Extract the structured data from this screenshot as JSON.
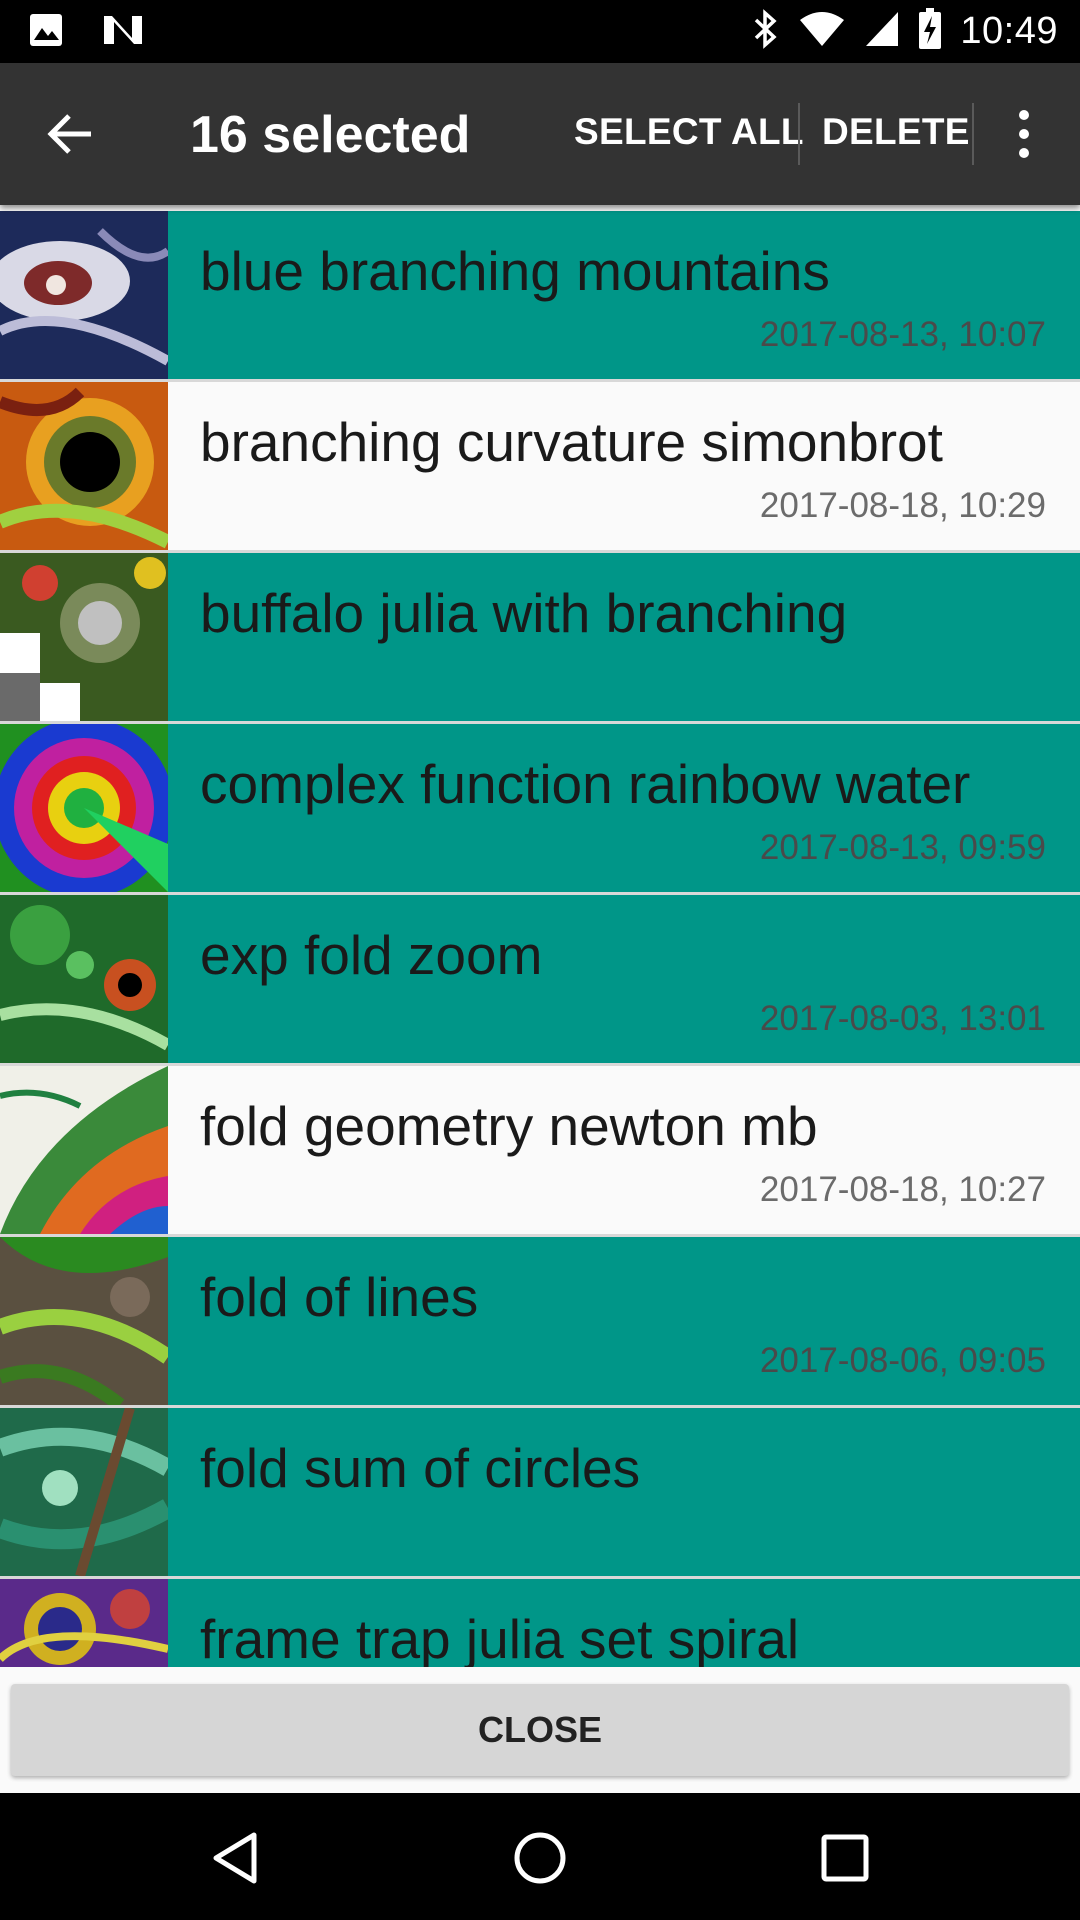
{
  "status_bar": {
    "time": "10:49",
    "icons": [
      "image-icon",
      "n-icon",
      "bluetooth-icon",
      "wifi-icon",
      "signal-icon",
      "battery-charging-icon"
    ]
  },
  "action_bar": {
    "title": "16 selected",
    "select_all_label": "SELECT ALL",
    "delete_label": "DELETE",
    "back_icon": "arrow-left-icon",
    "overflow_icon": "more-vert-icon"
  },
  "items": [
    {
      "title": "blue branching mountains",
      "date": "2017-08-13, 10:07",
      "selected": true
    },
    {
      "title": "branching curvature simonbrot",
      "date": "2017-08-18, 10:29",
      "selected": false
    },
    {
      "title": "buffalo julia with branching",
      "date": "",
      "selected": true
    },
    {
      "title": "complex function rainbow water",
      "date": "2017-08-13, 09:59",
      "selected": true
    },
    {
      "title": "exp fold zoom",
      "date": "2017-08-03, 13:01",
      "selected": true
    },
    {
      "title": "fold geometry newton mb",
      "date": "2017-08-18, 10:27",
      "selected": false
    },
    {
      "title": "fold of lines",
      "date": "2017-08-06, 09:05",
      "selected": true
    },
    {
      "title": "fold sum of circles",
      "date": "",
      "selected": true
    },
    {
      "title": "frame trap julia set spiral",
      "date": "",
      "selected": true
    }
  ],
  "close_label": "CLOSE",
  "colors": {
    "selected_row": "#009688",
    "unselected_row": "#fafafa",
    "action_bar": "#333333"
  },
  "nav_bar": {
    "icons": [
      "nav-back-icon",
      "nav-home-icon",
      "nav-recents-icon"
    ]
  }
}
